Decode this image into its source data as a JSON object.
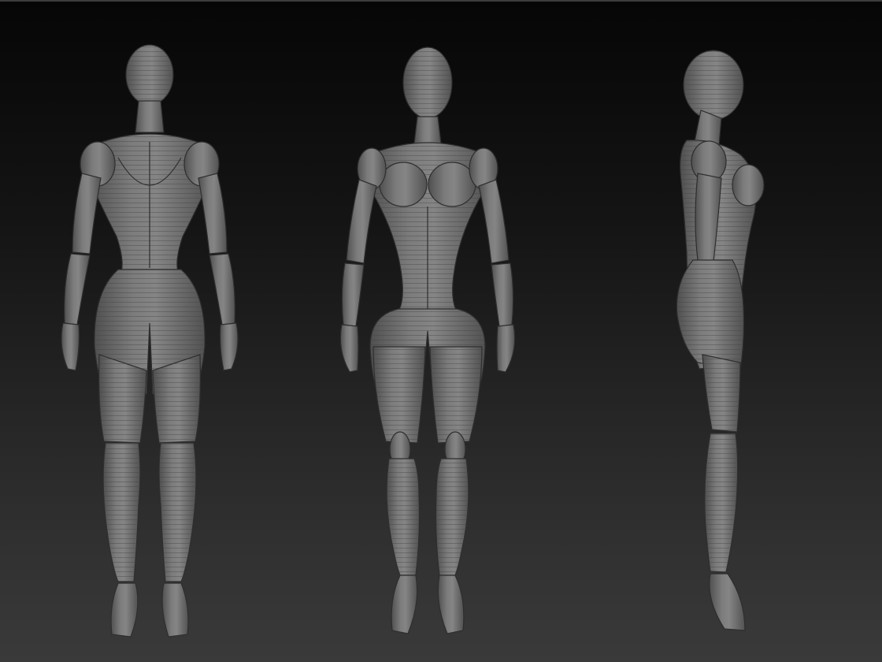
{
  "scene": {
    "figures": [
      {
        "view": "back"
      },
      {
        "view": "front"
      },
      {
        "view": "side"
      }
    ],
    "colors": {
      "background_top": "#060606",
      "background_bottom": "#3a3a3a",
      "mesh_light": "#8a8a8a",
      "mesh_mid": "#6e6e6e",
      "mesh_dark": "#4e4e4e",
      "edge": "#2e2e2e",
      "line": "#444444"
    }
  }
}
